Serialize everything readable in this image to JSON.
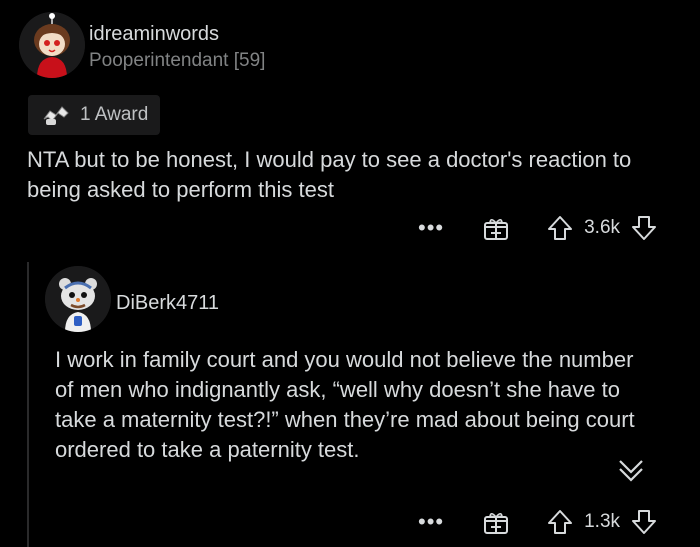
{
  "comment1": {
    "username": "idreaminwords",
    "flair": "Pooperintendant [59]",
    "award_label": "1 Award",
    "body": "NTA but to be honest, I would pay to see a doctor's reaction to being asked to perform this test",
    "more_label": "•••",
    "vote_count": "3.6k"
  },
  "comment2": {
    "username": "DiBerk4711",
    "body": "I work in family court and you would not believe the number of men who indignantly ask, “well why doesn’t she have to take a maternity test?!” when they’re mad about being court ordered to take a paternity test.",
    "more_label": "•••",
    "vote_count": "1.3k"
  },
  "colors": {
    "background": "#000000",
    "text": "#d7dadc",
    "muted": "#818384",
    "pill": "#1a1a1b"
  },
  "icons": [
    "avatar-icon",
    "award-icon",
    "more-icon",
    "gift-icon",
    "upvote-icon",
    "downvote-icon",
    "collapse-chevron-icon"
  ]
}
